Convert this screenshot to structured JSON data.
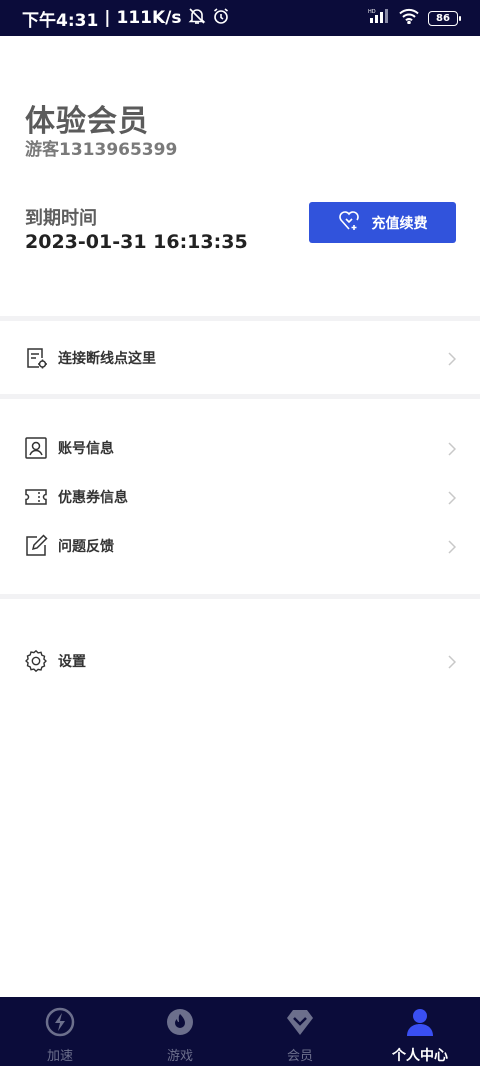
{
  "status_bar": {
    "time": "下午4:31",
    "separator": "|",
    "net_speed": "111K/s",
    "battery": "86"
  },
  "profile": {
    "member_title": "体验会员",
    "guest_id": "游客1313965399",
    "expire_label": "到期时间",
    "expire_time": "2023-01-31 16:13:35",
    "recharge_label": "充值续费"
  },
  "menu": [
    {
      "label": "连接断线点这里",
      "icon": "document-gear-icon"
    },
    {
      "label": "账号信息",
      "icon": "id-card-icon"
    },
    {
      "label": "优惠券信息",
      "icon": "coupon-icon"
    },
    {
      "label": "问题反馈",
      "icon": "edit-icon"
    },
    {
      "label": "设置",
      "icon": "settings-icon"
    }
  ],
  "tabs": [
    {
      "label": "加速",
      "icon": "lightning-icon",
      "active": false
    },
    {
      "label": "游戏",
      "icon": "flame-icon",
      "active": false
    },
    {
      "label": "会员",
      "icon": "diamond-icon",
      "active": false
    },
    {
      "label": "个人中心",
      "icon": "person-icon",
      "active": true
    }
  ],
  "colors": {
    "accent": "#3153dc",
    "nav_bg": "#0b0c3a",
    "active_tab": "#3a4ff2"
  }
}
